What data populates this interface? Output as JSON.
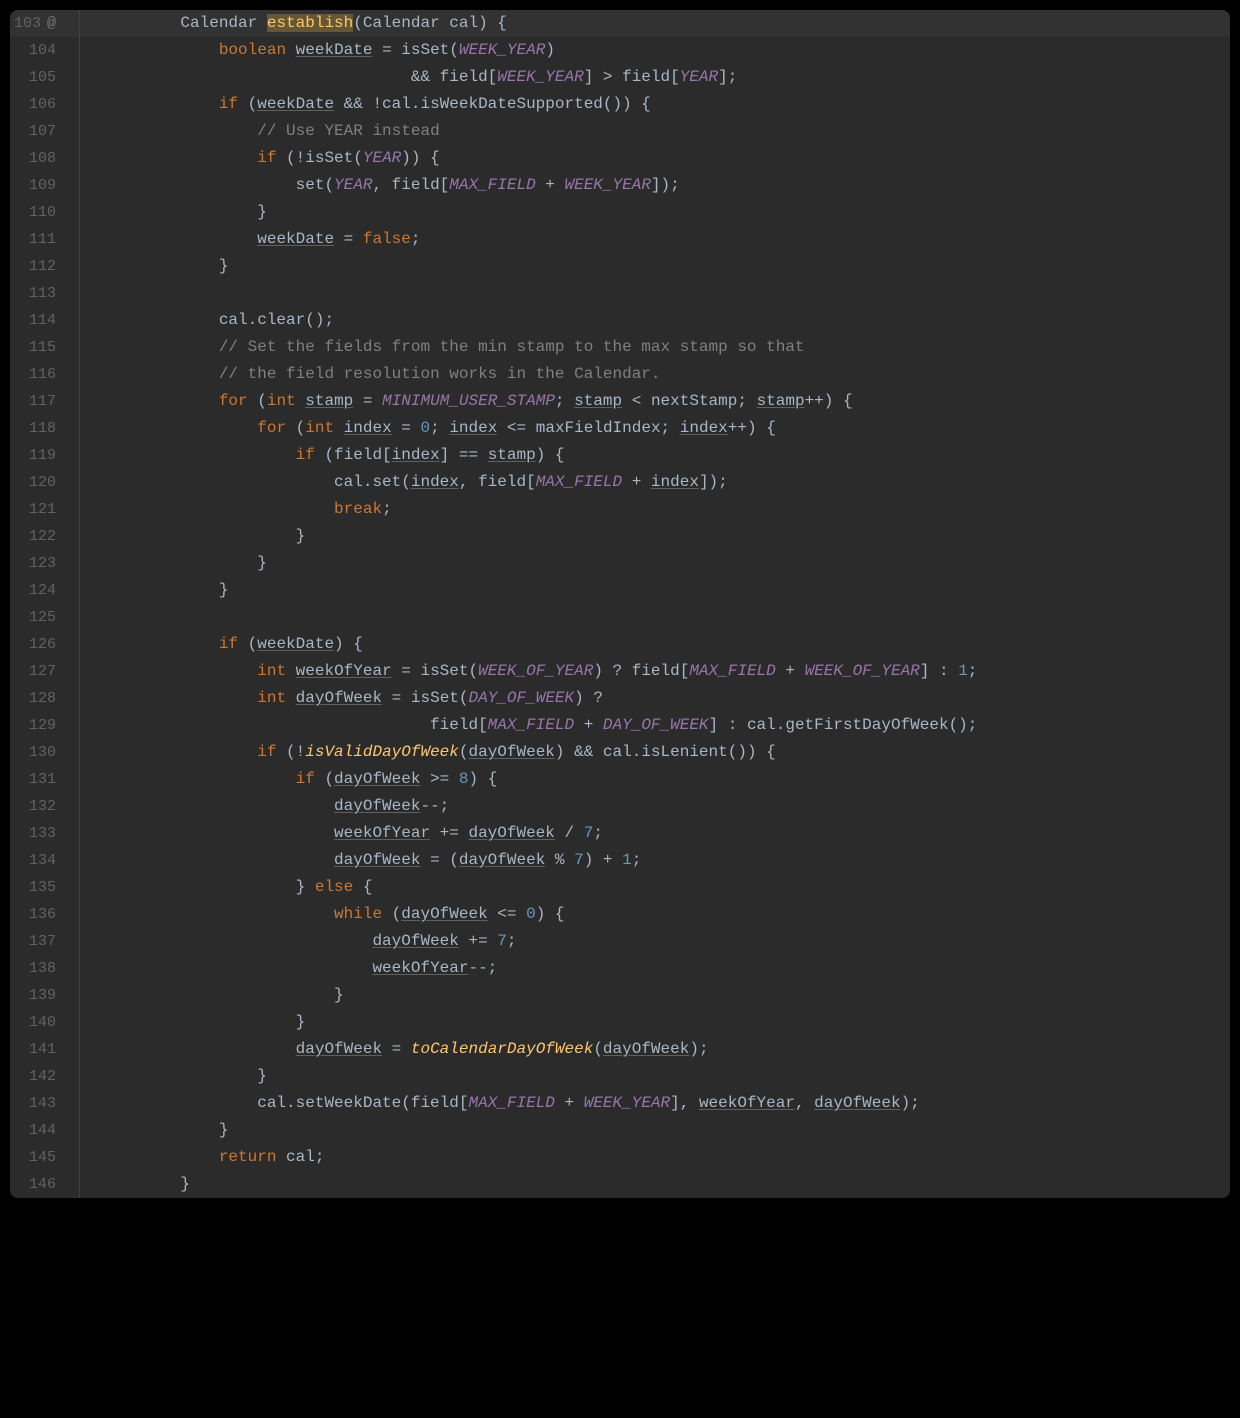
{
  "startLine": 103,
  "highlightedLine": 103,
  "lines": [
    {
      "num": 103,
      "at": true,
      "tokens": [
        [
          "",
          "         "
        ],
        [
          "type",
          "Calendar "
        ],
        [
          "method cursor-bg",
          "establish"
        ],
        [
          "",
          "(Calendar cal) {"
        ]
      ]
    },
    {
      "num": 104,
      "tokens": [
        [
          "",
          "             "
        ],
        [
          "kw",
          "boolean"
        ],
        [
          "",
          " "
        ],
        [
          "u",
          "weekDate"
        ],
        [
          "",
          " = isSet("
        ],
        [
          "const",
          "WEEK_YEAR"
        ],
        [
          "",
          ")"
        ]
      ]
    },
    {
      "num": 105,
      "tokens": [
        [
          "",
          "                                 && field["
        ],
        [
          "const",
          "WEEK_YEAR"
        ],
        [
          "",
          "] > field["
        ],
        [
          "const",
          "YEAR"
        ],
        [
          "",
          "];"
        ]
      ]
    },
    {
      "num": 106,
      "tokens": [
        [
          "",
          "             "
        ],
        [
          "kw",
          "if"
        ],
        [
          "",
          " ("
        ],
        [
          "u",
          "weekDate"
        ],
        [
          "",
          " && !cal.isWeekDateSupported()) {"
        ]
      ]
    },
    {
      "num": 107,
      "tokens": [
        [
          "",
          "                 "
        ],
        [
          "cmt",
          "// Use YEAR instead"
        ]
      ]
    },
    {
      "num": 108,
      "tokens": [
        [
          "",
          "                 "
        ],
        [
          "kw",
          "if"
        ],
        [
          "",
          " (!isSet("
        ],
        [
          "const",
          "YEAR"
        ],
        [
          "",
          ")) {"
        ]
      ]
    },
    {
      "num": 109,
      "tokens": [
        [
          "",
          "                     set("
        ],
        [
          "const",
          "YEAR"
        ],
        [
          "",
          ", field["
        ],
        [
          "const",
          "MAX_FIELD"
        ],
        [
          "",
          " + "
        ],
        [
          "const",
          "WEEK_YEAR"
        ],
        [
          "",
          "]);"
        ]
      ]
    },
    {
      "num": 110,
      "tokens": [
        [
          "",
          "                 }"
        ]
      ]
    },
    {
      "num": 111,
      "tokens": [
        [
          "",
          "                 "
        ],
        [
          "u",
          "weekDate"
        ],
        [
          "",
          " = "
        ],
        [
          "kw",
          "false"
        ],
        [
          "",
          ";"
        ]
      ]
    },
    {
      "num": 112,
      "tokens": [
        [
          "",
          "             }"
        ]
      ]
    },
    {
      "num": 113,
      "tokens": [
        [
          "",
          ""
        ]
      ]
    },
    {
      "num": 114,
      "tokens": [
        [
          "",
          "             cal.clear();"
        ]
      ]
    },
    {
      "num": 115,
      "tokens": [
        [
          "",
          "             "
        ],
        [
          "cmt",
          "// Set the fields from the min stamp to the max stamp so that"
        ]
      ]
    },
    {
      "num": 116,
      "tokens": [
        [
          "",
          "             "
        ],
        [
          "cmt",
          "// the field resolution works in the Calendar."
        ]
      ]
    },
    {
      "num": 117,
      "tokens": [
        [
          "",
          "             "
        ],
        [
          "kw",
          "for"
        ],
        [
          "",
          " ("
        ],
        [
          "kw",
          "int"
        ],
        [
          "",
          " "
        ],
        [
          "u",
          "stamp"
        ],
        [
          "",
          " = "
        ],
        [
          "const",
          "MINIMUM_USER_STAMP"
        ],
        [
          "",
          "; "
        ],
        [
          "u",
          "stamp"
        ],
        [
          "",
          " < nextStamp; "
        ],
        [
          "u",
          "stamp"
        ],
        [
          "",
          "++) {"
        ]
      ]
    },
    {
      "num": 118,
      "tokens": [
        [
          "",
          "                 "
        ],
        [
          "kw",
          "for"
        ],
        [
          "",
          " ("
        ],
        [
          "kw",
          "int"
        ],
        [
          "",
          " "
        ],
        [
          "u",
          "index"
        ],
        [
          "",
          " = "
        ],
        [
          "num",
          "0"
        ],
        [
          "",
          "; "
        ],
        [
          "u",
          "index"
        ],
        [
          "",
          " <= maxFieldIndex; "
        ],
        [
          "u",
          "index"
        ],
        [
          "",
          "++) {"
        ]
      ]
    },
    {
      "num": 119,
      "tokens": [
        [
          "",
          "                     "
        ],
        [
          "kw",
          "if"
        ],
        [
          "",
          " (field["
        ],
        [
          "u",
          "index"
        ],
        [
          "",
          "] == "
        ],
        [
          "u",
          "stamp"
        ],
        [
          "",
          ") {"
        ]
      ]
    },
    {
      "num": 120,
      "tokens": [
        [
          "",
          "                         cal.set("
        ],
        [
          "u",
          "index"
        ],
        [
          "",
          ", field["
        ],
        [
          "const",
          "MAX_FIELD"
        ],
        [
          "",
          " + "
        ],
        [
          "u",
          "index"
        ],
        [
          "",
          "]);"
        ]
      ]
    },
    {
      "num": 121,
      "tokens": [
        [
          "",
          "                         "
        ],
        [
          "kw",
          "break"
        ],
        [
          "",
          ";"
        ]
      ]
    },
    {
      "num": 122,
      "tokens": [
        [
          "",
          "                     }"
        ]
      ]
    },
    {
      "num": 123,
      "tokens": [
        [
          "",
          "                 }"
        ]
      ]
    },
    {
      "num": 124,
      "tokens": [
        [
          "",
          "             }"
        ]
      ]
    },
    {
      "num": 125,
      "tokens": [
        [
          "",
          ""
        ]
      ]
    },
    {
      "num": 126,
      "tokens": [
        [
          "",
          "             "
        ],
        [
          "kw",
          "if"
        ],
        [
          "",
          " ("
        ],
        [
          "u",
          "weekDate"
        ],
        [
          "",
          ") {"
        ]
      ]
    },
    {
      "num": 127,
      "tokens": [
        [
          "",
          "                 "
        ],
        [
          "kw",
          "int"
        ],
        [
          "",
          " "
        ],
        [
          "u",
          "weekOfYear"
        ],
        [
          "",
          " = isSet("
        ],
        [
          "const",
          "WEEK_OF_YEAR"
        ],
        [
          "",
          ") ? field["
        ],
        [
          "const",
          "MAX_FIELD"
        ],
        [
          "",
          " + "
        ],
        [
          "const",
          "WEEK_OF_YEAR"
        ],
        [
          "",
          "] : "
        ],
        [
          "num",
          "1"
        ],
        [
          "",
          ";"
        ]
      ]
    },
    {
      "num": 128,
      "tokens": [
        [
          "",
          "                 "
        ],
        [
          "kw",
          "int"
        ],
        [
          "",
          " "
        ],
        [
          "u",
          "dayOfWeek"
        ],
        [
          "",
          " = isSet("
        ],
        [
          "const",
          "DAY_OF_WEEK"
        ],
        [
          "",
          ") ?"
        ]
      ]
    },
    {
      "num": 129,
      "tokens": [
        [
          "",
          "                                   field["
        ],
        [
          "const",
          "MAX_FIELD"
        ],
        [
          "",
          " + "
        ],
        [
          "const",
          "DAY_OF_WEEK"
        ],
        [
          "",
          "] : cal.getFirstDayOfWeek();"
        ]
      ]
    },
    {
      "num": 130,
      "tokens": [
        [
          "",
          "                 "
        ],
        [
          "kw",
          "if"
        ],
        [
          "",
          " (!"
        ],
        [
          "methodi",
          "isValidDayOfWeek"
        ],
        [
          "",
          "("
        ],
        [
          "u",
          "dayOfWeek"
        ],
        [
          "",
          ") && cal.isLenient()) {"
        ]
      ]
    },
    {
      "num": 131,
      "tokens": [
        [
          "",
          "                     "
        ],
        [
          "kw",
          "if"
        ],
        [
          "",
          " ("
        ],
        [
          "u",
          "dayOfWeek"
        ],
        [
          "",
          " >= "
        ],
        [
          "num",
          "8"
        ],
        [
          "",
          ") {"
        ]
      ]
    },
    {
      "num": 132,
      "tokens": [
        [
          "",
          "                         "
        ],
        [
          "u",
          "dayOfWeek"
        ],
        [
          "",
          "--;"
        ]
      ]
    },
    {
      "num": 133,
      "tokens": [
        [
          "",
          "                         "
        ],
        [
          "u",
          "weekOfYear"
        ],
        [
          "",
          " += "
        ],
        [
          "u",
          "dayOfWeek"
        ],
        [
          "",
          " / "
        ],
        [
          "num",
          "7"
        ],
        [
          "",
          ";"
        ]
      ]
    },
    {
      "num": 134,
      "tokens": [
        [
          "",
          "                         "
        ],
        [
          "u",
          "dayOfWeek"
        ],
        [
          "",
          " = ("
        ],
        [
          "u",
          "dayOfWeek"
        ],
        [
          "",
          " % "
        ],
        [
          "num",
          "7"
        ],
        [
          "",
          ") + "
        ],
        [
          "num",
          "1"
        ],
        [
          "",
          ";"
        ]
      ]
    },
    {
      "num": 135,
      "tokens": [
        [
          "",
          "                     } "
        ],
        [
          "kw",
          "else"
        ],
        [
          "",
          " {"
        ]
      ]
    },
    {
      "num": 136,
      "tokens": [
        [
          "",
          "                         "
        ],
        [
          "kw",
          "while"
        ],
        [
          "",
          " ("
        ],
        [
          "u",
          "dayOfWeek"
        ],
        [
          "",
          " <= "
        ],
        [
          "num",
          "0"
        ],
        [
          "",
          ") {"
        ]
      ]
    },
    {
      "num": 137,
      "tokens": [
        [
          "",
          "                             "
        ],
        [
          "u",
          "dayOfWeek"
        ],
        [
          "",
          " += "
        ],
        [
          "num",
          "7"
        ],
        [
          "",
          ";"
        ]
      ]
    },
    {
      "num": 138,
      "tokens": [
        [
          "",
          "                             "
        ],
        [
          "u",
          "weekOfYear"
        ],
        [
          "",
          "--;"
        ]
      ]
    },
    {
      "num": 139,
      "tokens": [
        [
          "",
          "                         }"
        ]
      ]
    },
    {
      "num": 140,
      "tokens": [
        [
          "",
          "                     }"
        ]
      ]
    },
    {
      "num": 141,
      "tokens": [
        [
          "",
          "                     "
        ],
        [
          "u",
          "dayOfWeek"
        ],
        [
          "",
          " = "
        ],
        [
          "methodi",
          "toCalendarDayOfWeek"
        ],
        [
          "",
          "("
        ],
        [
          "u",
          "dayOfWeek"
        ],
        [
          "",
          ");"
        ]
      ]
    },
    {
      "num": 142,
      "tokens": [
        [
          "",
          "                 }"
        ]
      ]
    },
    {
      "num": 143,
      "tokens": [
        [
          "",
          "                 cal.setWeekDate(field["
        ],
        [
          "const",
          "MAX_FIELD"
        ],
        [
          "",
          " + "
        ],
        [
          "const",
          "WEEK_YEAR"
        ],
        [
          "",
          "], "
        ],
        [
          "u",
          "weekOfYear"
        ],
        [
          "",
          ", "
        ],
        [
          "u",
          "dayOfWeek"
        ],
        [
          "",
          ");"
        ]
      ]
    },
    {
      "num": 144,
      "tokens": [
        [
          "",
          "             }"
        ]
      ]
    },
    {
      "num": 145,
      "tokens": [
        [
          "",
          "             "
        ],
        [
          "kw",
          "return"
        ],
        [
          "",
          " cal;"
        ]
      ]
    },
    {
      "num": 146,
      "tokens": [
        [
          "",
          "         }"
        ]
      ]
    }
  ]
}
